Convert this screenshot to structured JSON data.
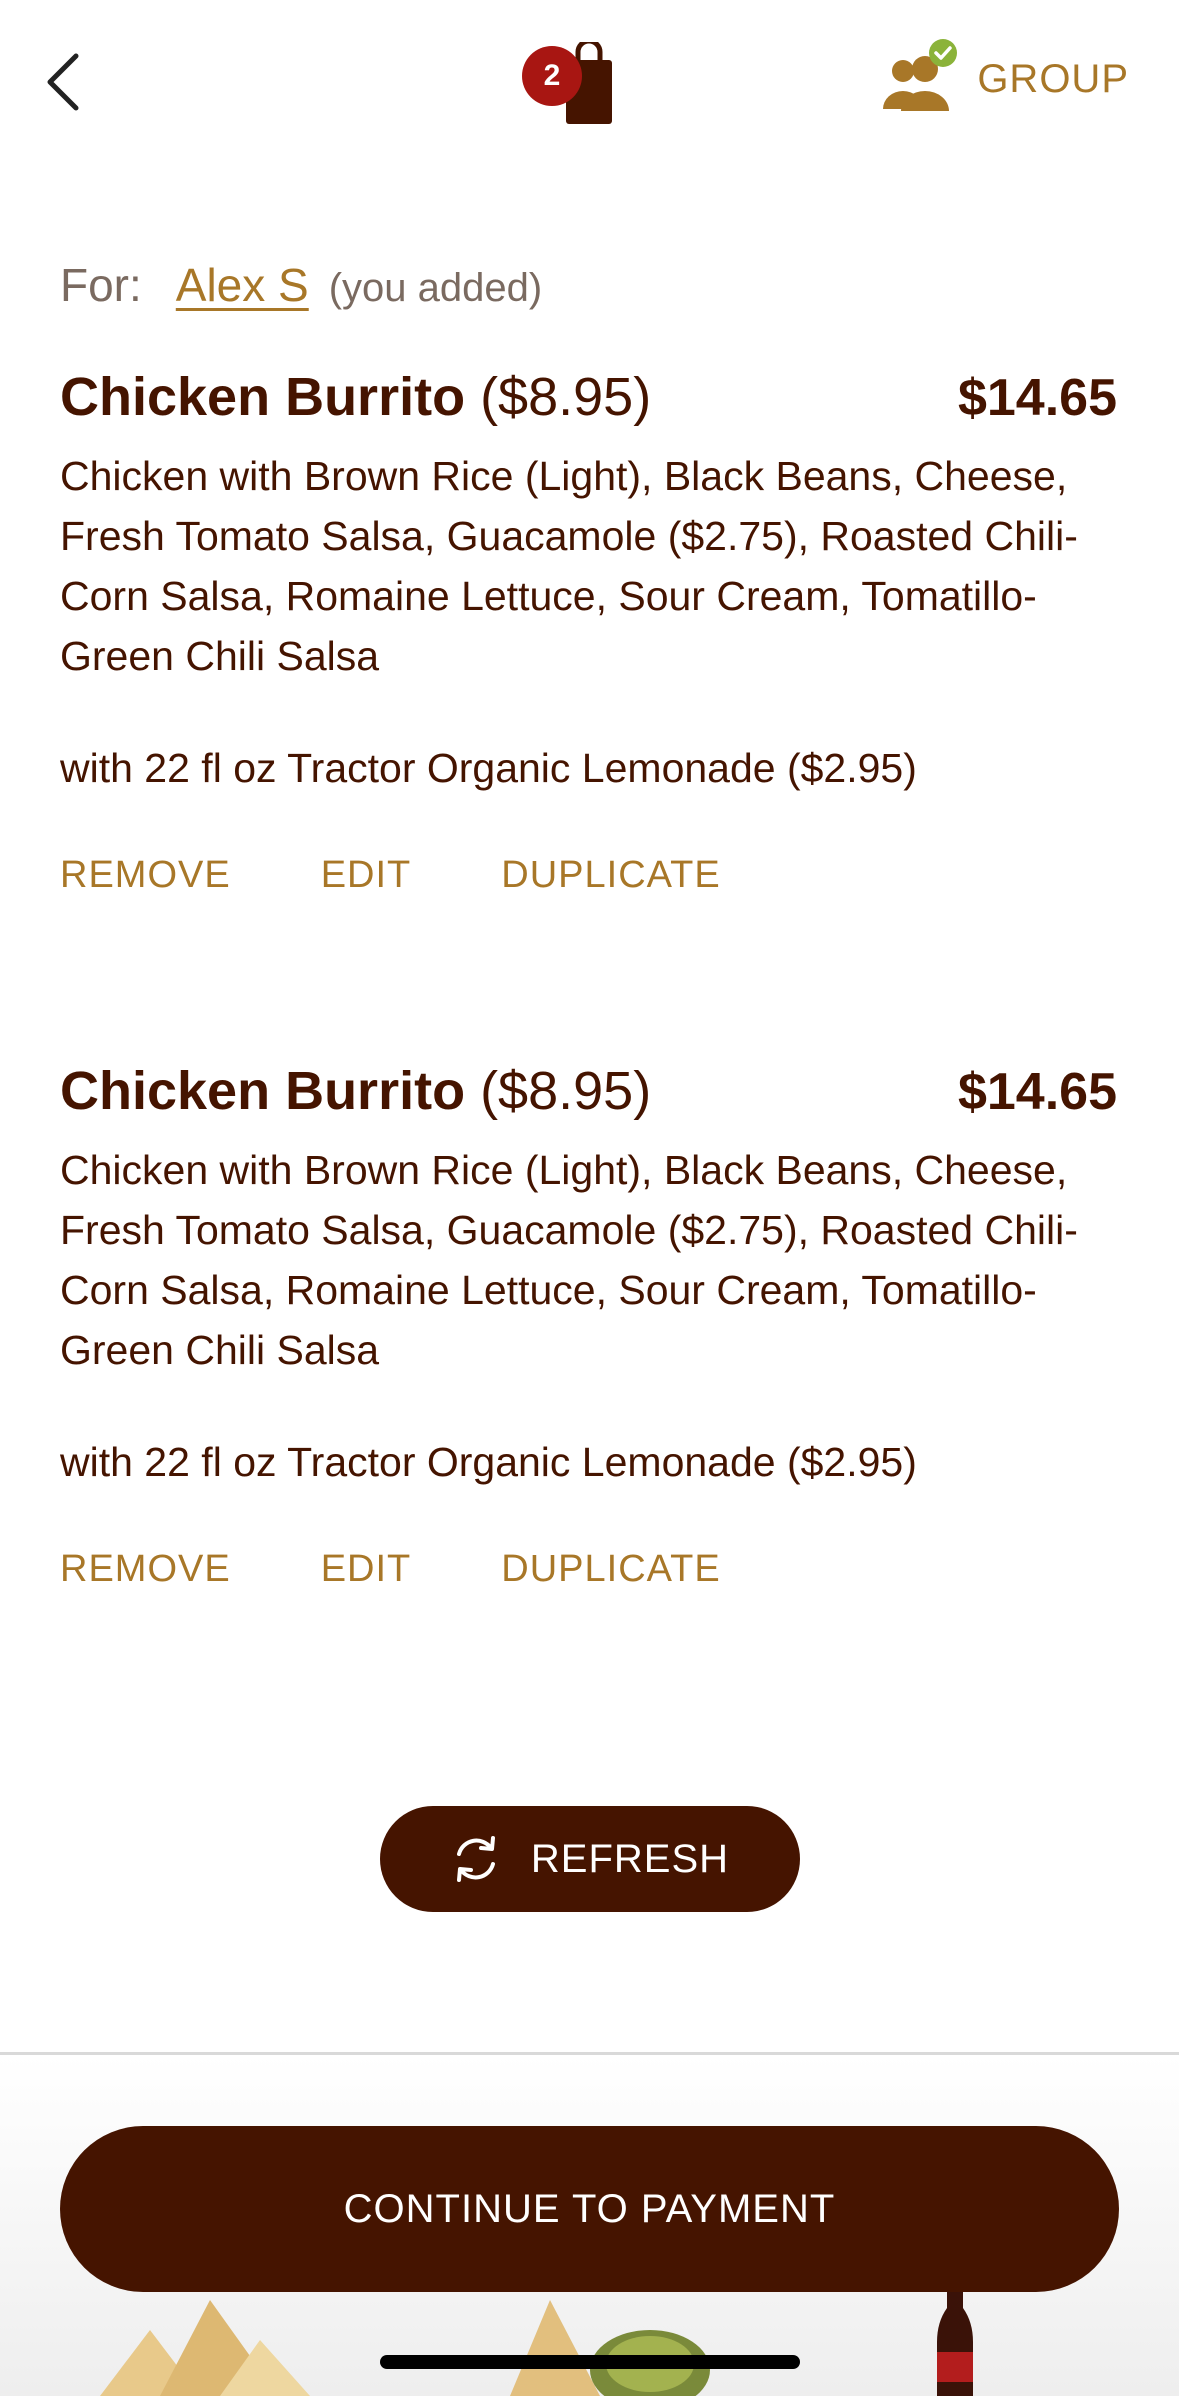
{
  "header": {
    "bag_count": "2",
    "group_label": "GROUP"
  },
  "order_for": {
    "label": "For:",
    "name": "Alex S",
    "note": "(you added)"
  },
  "items": [
    {
      "name": "Chicken Burrito",
      "base_price": "($8.95)",
      "total": "$14.65",
      "description": "Chicken with Brown Rice (Light), Black Beans, Cheese, Fresh Tomato Salsa, Guacamole ($2.75), Roasted Chili-Corn Salsa, Romaine Lettuce, Sour Cream, Tomatillo-Green Chili Salsa",
      "drink": "with 22 fl oz Tractor Organic Lemonade ($2.95)",
      "actions": {
        "remove": "REMOVE",
        "edit": "EDIT",
        "duplicate": "DUPLICATE"
      }
    },
    {
      "name": "Chicken Burrito",
      "base_price": "($8.95)",
      "total": "$14.65",
      "description": "Chicken with Brown Rice (Light), Black Beans, Cheese, Fresh Tomato Salsa, Guacamole ($2.75), Roasted Chili-Corn Salsa, Romaine Lettuce, Sour Cream, Tomatillo-Green Chili Salsa",
      "drink": "with 22 fl oz Tractor Organic Lemonade ($2.95)",
      "actions": {
        "remove": "REMOVE",
        "edit": "EDIT",
        "duplicate": "DUPLICATE"
      }
    }
  ],
  "refresh_label": "REFRESH",
  "continue_label": "CONTINUE TO PAYMENT",
  "colors": {
    "brand_brown": "#451400",
    "accent_gold": "#a87728",
    "badge_red": "#a81612",
    "check_green": "#8bb33a"
  },
  "icons": [
    "back-chevron-icon",
    "bag-icon",
    "group-icon",
    "refresh-icon"
  ]
}
